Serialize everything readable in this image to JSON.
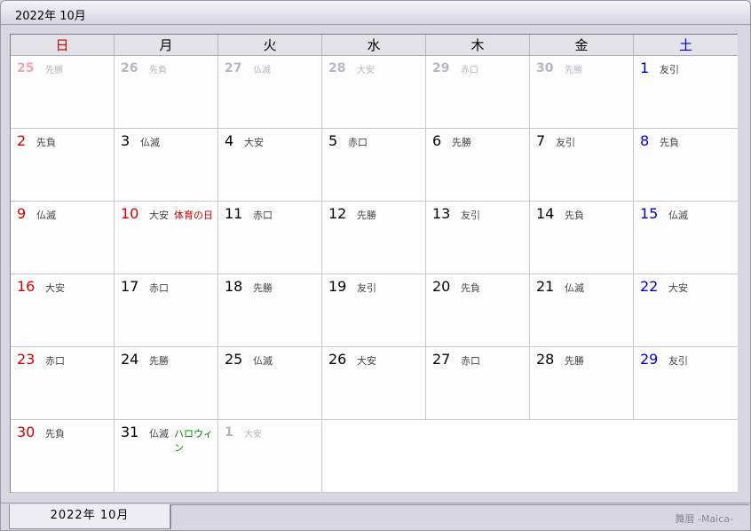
{
  "window": {
    "title": "2022年 10月"
  },
  "weekdays": [
    {
      "label": "日",
      "color": "#d00000"
    },
    {
      "label": "月",
      "color": "#000000"
    },
    {
      "label": "火",
      "color": "#000000"
    },
    {
      "label": "水",
      "color": "#000000"
    },
    {
      "label": "木",
      "color": "#000000"
    },
    {
      "label": "金",
      "color": "#000000"
    },
    {
      "label": "土",
      "color": "#0000c0"
    }
  ],
  "weeks": [
    [
      {
        "day": "25",
        "rokuyo": "先勝",
        "other": true,
        "color": "#f0a8a8"
      },
      {
        "day": "26",
        "rokuyo": "先負",
        "other": true
      },
      {
        "day": "27",
        "rokuyo": "仏滅",
        "other": true
      },
      {
        "day": "28",
        "rokuyo": "大安",
        "other": true
      },
      {
        "day": "29",
        "rokuyo": "赤口",
        "other": true
      },
      {
        "day": "30",
        "rokuyo": "先勝",
        "other": true
      },
      {
        "day": "1",
        "rokuyo": "友引",
        "color": "#0000c0"
      }
    ],
    [
      {
        "day": "2",
        "rokuyo": "先負",
        "color": "#d00000"
      },
      {
        "day": "3",
        "rokuyo": "仏滅"
      },
      {
        "day": "4",
        "rokuyo": "大安"
      },
      {
        "day": "5",
        "rokuyo": "赤口"
      },
      {
        "day": "6",
        "rokuyo": "先勝"
      },
      {
        "day": "7",
        "rokuyo": "友引"
      },
      {
        "day": "8",
        "rokuyo": "先負",
        "color": "#0000c0"
      }
    ],
    [
      {
        "day": "9",
        "rokuyo": "仏滅",
        "color": "#d00000"
      },
      {
        "day": "10",
        "rokuyo": "大安",
        "color": "#d00000",
        "holiday": "体育の日",
        "holiday_color": "#d00000"
      },
      {
        "day": "11",
        "rokuyo": "赤口"
      },
      {
        "day": "12",
        "rokuyo": "先勝"
      },
      {
        "day": "13",
        "rokuyo": "友引"
      },
      {
        "day": "14",
        "rokuyo": "先負"
      },
      {
        "day": "15",
        "rokuyo": "仏滅",
        "color": "#0000c0"
      }
    ],
    [
      {
        "day": "16",
        "rokuyo": "大安",
        "color": "#d00000"
      },
      {
        "day": "17",
        "rokuyo": "赤口"
      },
      {
        "day": "18",
        "rokuyo": "先勝"
      },
      {
        "day": "19",
        "rokuyo": "友引"
      },
      {
        "day": "20",
        "rokuyo": "先負"
      },
      {
        "day": "21",
        "rokuyo": "仏滅"
      },
      {
        "day": "22",
        "rokuyo": "大安",
        "color": "#0000c0"
      }
    ],
    [
      {
        "day": "23",
        "rokuyo": "赤口",
        "color": "#d00000"
      },
      {
        "day": "24",
        "rokuyo": "先勝"
      },
      {
        "day": "25",
        "rokuyo": "仏滅"
      },
      {
        "day": "26",
        "rokuyo": "大安"
      },
      {
        "day": "27",
        "rokuyo": "赤口"
      },
      {
        "day": "28",
        "rokuyo": "先勝"
      },
      {
        "day": "29",
        "rokuyo": "友引",
        "color": "#0000c0"
      }
    ],
    [
      {
        "day": "30",
        "rokuyo": "先負",
        "color": "#d00000"
      },
      {
        "day": "31",
        "rokuyo": "仏滅",
        "holiday": "ハロウィン",
        "holiday_color": "#008000"
      },
      {
        "day": "1",
        "rokuyo": "大安",
        "other": true
      }
    ]
  ],
  "footer": {
    "tab_label": "2022年 10月",
    "brand": "舞暦 -Maica-"
  }
}
